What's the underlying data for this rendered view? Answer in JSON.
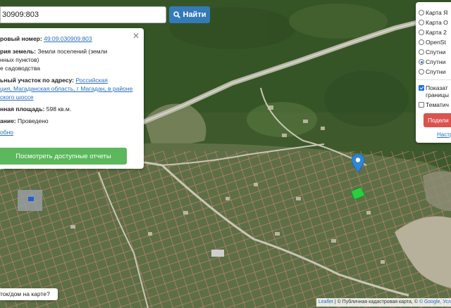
{
  "search": {
    "value": "30909:803",
    "button_label": "Найти"
  },
  "info_panel": {
    "cadastral_label": "ровый номер:",
    "cadastral_value": "49:09:030909:803",
    "category_label": "рия земель:",
    "category_value_line1": "Земли поселений (земли",
    "category_value_line2": "нных пунктов)",
    "usage_line": "е садоводства",
    "address_label": "ьный участок по адресу:",
    "address_link_part1": "Российская",
    "address_link_line2": "ция, Магаданская область, г Магадан, в районе",
    "address_link_line3": "ского шоссе",
    "area_label": "нная площадь:",
    "area_value": "598 кв.м.",
    "status_label": "ание:",
    "status_value": "Проведено",
    "more_link": "обно",
    "reports_button": "Посмотреть доступные отчеты"
  },
  "layers_panel": {
    "base_layers": [
      {
        "label": "Карта Я",
        "selected": false
      },
      {
        "label": "Карта О",
        "selected": false
      },
      {
        "label": "Карта 2",
        "selected": false
      },
      {
        "label": "OpenSt",
        "selected": false
      },
      {
        "label": "Спутни",
        "selected": false
      },
      {
        "label": "Спутни",
        "selected": true
      },
      {
        "label": "Спутни",
        "selected": false
      }
    ],
    "overlay_1_line1": "Показат",
    "overlay_1_line2": "границы",
    "overlay_1_checked": true,
    "overlay_2": "Тематич",
    "overlay_2_checked": false,
    "share_button": "Подели",
    "settings_link": "Настр"
  },
  "bottom_question": "ток/дом на карте?",
  "attribution": {
    "leaflet": "Leaflet",
    "text": "| © Публичная кадастровая карта, ©",
    "google": "© Google,",
    "tail": "Усл"
  },
  "colors": {
    "primary_blue": "#337ab7",
    "green_button": "#5cb85c",
    "red_button": "#d9534f",
    "marker_blue": "#2f86d6",
    "selected_parcel": "#2ecc40"
  },
  "icons": {
    "search_button_icon": "search-icon",
    "close_icon": "close-icon",
    "map_marker": "map-marker-icon"
  }
}
